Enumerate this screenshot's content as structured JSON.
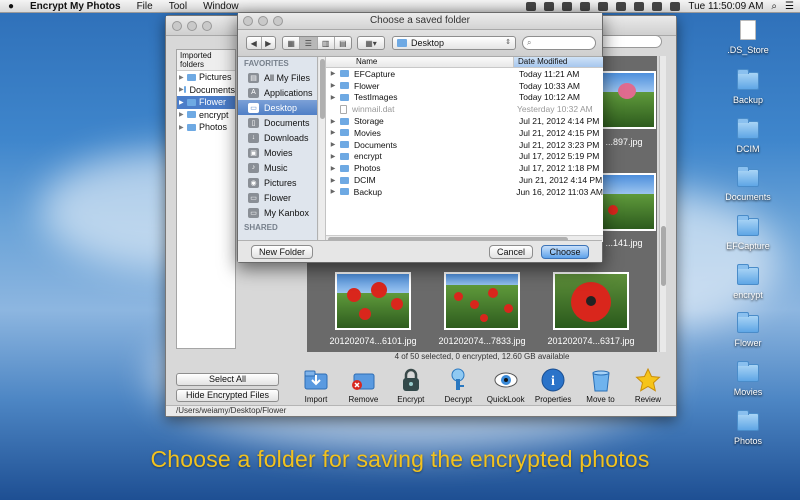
{
  "menubar": {
    "app_name": "Encrypt My Photos",
    "menus": [
      "File",
      "Tool",
      "Window"
    ],
    "clock": "Tue 11:50:09 AM"
  },
  "desktop": {
    "icons": [
      ".DS_Store",
      "Backup",
      "DCIM",
      "Documents",
      "EFCapture",
      "encrypt",
      "Flower",
      "Movies",
      "Photos"
    ]
  },
  "main_window": {
    "tree_header": "Imported folders",
    "tree_items": [
      "Pictures",
      "Documents",
      "Flower",
      "encrypt",
      "Photos"
    ],
    "selected_tree_item": "Flower",
    "photo_captions_top": [
      "...897.jpg",
      "...141.jpg"
    ],
    "photos": [
      "201202074...6101.jpg",
      "201202074...7833.jpg",
      "201202074...6317.jpg"
    ],
    "status": "4 of 50 selected, 0 encrypted, 12.60 GB available",
    "select_all_label": "Select All",
    "hide_encrypted_label": "Hide Encrypted Files",
    "toolbar": [
      {
        "label": "Import",
        "icon": "import-icon"
      },
      {
        "label": "Remove",
        "icon": "remove-icon"
      },
      {
        "label": "Encrypt",
        "icon": "lock-icon"
      },
      {
        "label": "Decrypt",
        "icon": "key-icon"
      },
      {
        "label": "QuickLook",
        "icon": "eye-icon"
      },
      {
        "label": "Properties",
        "icon": "info-icon"
      },
      {
        "label": "Move to trash",
        "icon": "trash-icon"
      },
      {
        "label": "Review",
        "icon": "star-icon"
      }
    ],
    "path": "/Users/weiamy/Desktop/Flower"
  },
  "dialog": {
    "title": "Choose a saved folder",
    "location": "Desktop",
    "sidebar": {
      "favorites_header": "FAVORITES",
      "items": [
        {
          "label": "All My Files",
          "icon": "all-files-icon"
        },
        {
          "label": "Applications",
          "icon": "applications-icon"
        },
        {
          "label": "Desktop",
          "icon": "desktop-icon"
        },
        {
          "label": "Documents",
          "icon": "documents-icon"
        },
        {
          "label": "Downloads",
          "icon": "downloads-icon"
        },
        {
          "label": "Movies",
          "icon": "movies-icon"
        },
        {
          "label": "Music",
          "icon": "music-icon"
        },
        {
          "label": "Pictures",
          "icon": "pictures-icon"
        },
        {
          "label": "Flower",
          "icon": "folder-icon"
        },
        {
          "label": "My Kanbox",
          "icon": "folder-icon"
        }
      ],
      "selected": "Desktop",
      "shared_header": "SHARED"
    },
    "columns": {
      "name": "Name",
      "date": "Date Modified"
    },
    "files": [
      {
        "name": "EFCapture",
        "date": "Today 11:21 AM",
        "folder": true
      },
      {
        "name": "Flower",
        "date": "Today 10:33 AM",
        "folder": true
      },
      {
        "name": "TestImages",
        "date": "Today 10:12 AM",
        "folder": true
      },
      {
        "name": "winmail.dat",
        "date": "Yesterday 10:32 AM",
        "folder": false
      },
      {
        "name": "Storage",
        "date": "Jul 21, 2012 4:14 PM",
        "folder": true
      },
      {
        "name": "Movies",
        "date": "Jul 21, 2012 4:15 PM",
        "folder": true
      },
      {
        "name": "Documents",
        "date": "Jul 21, 2012 3:23 PM",
        "folder": true
      },
      {
        "name": "encrypt",
        "date": "Jul 17, 2012 5:19 PM",
        "folder": true
      },
      {
        "name": "Photos",
        "date": "Jul 17, 2012 1:18 PM",
        "folder": true
      },
      {
        "name": "DCIM",
        "date": "Jun 21, 2012 4:14 PM",
        "folder": true
      },
      {
        "name": "Backup",
        "date": "Jun 16, 2012 11:03 AM",
        "folder": true
      }
    ],
    "new_folder_label": "New Folder",
    "cancel_label": "Cancel",
    "choose_label": "Choose"
  },
  "caption": "Choose a folder for saving the encrypted photos"
}
